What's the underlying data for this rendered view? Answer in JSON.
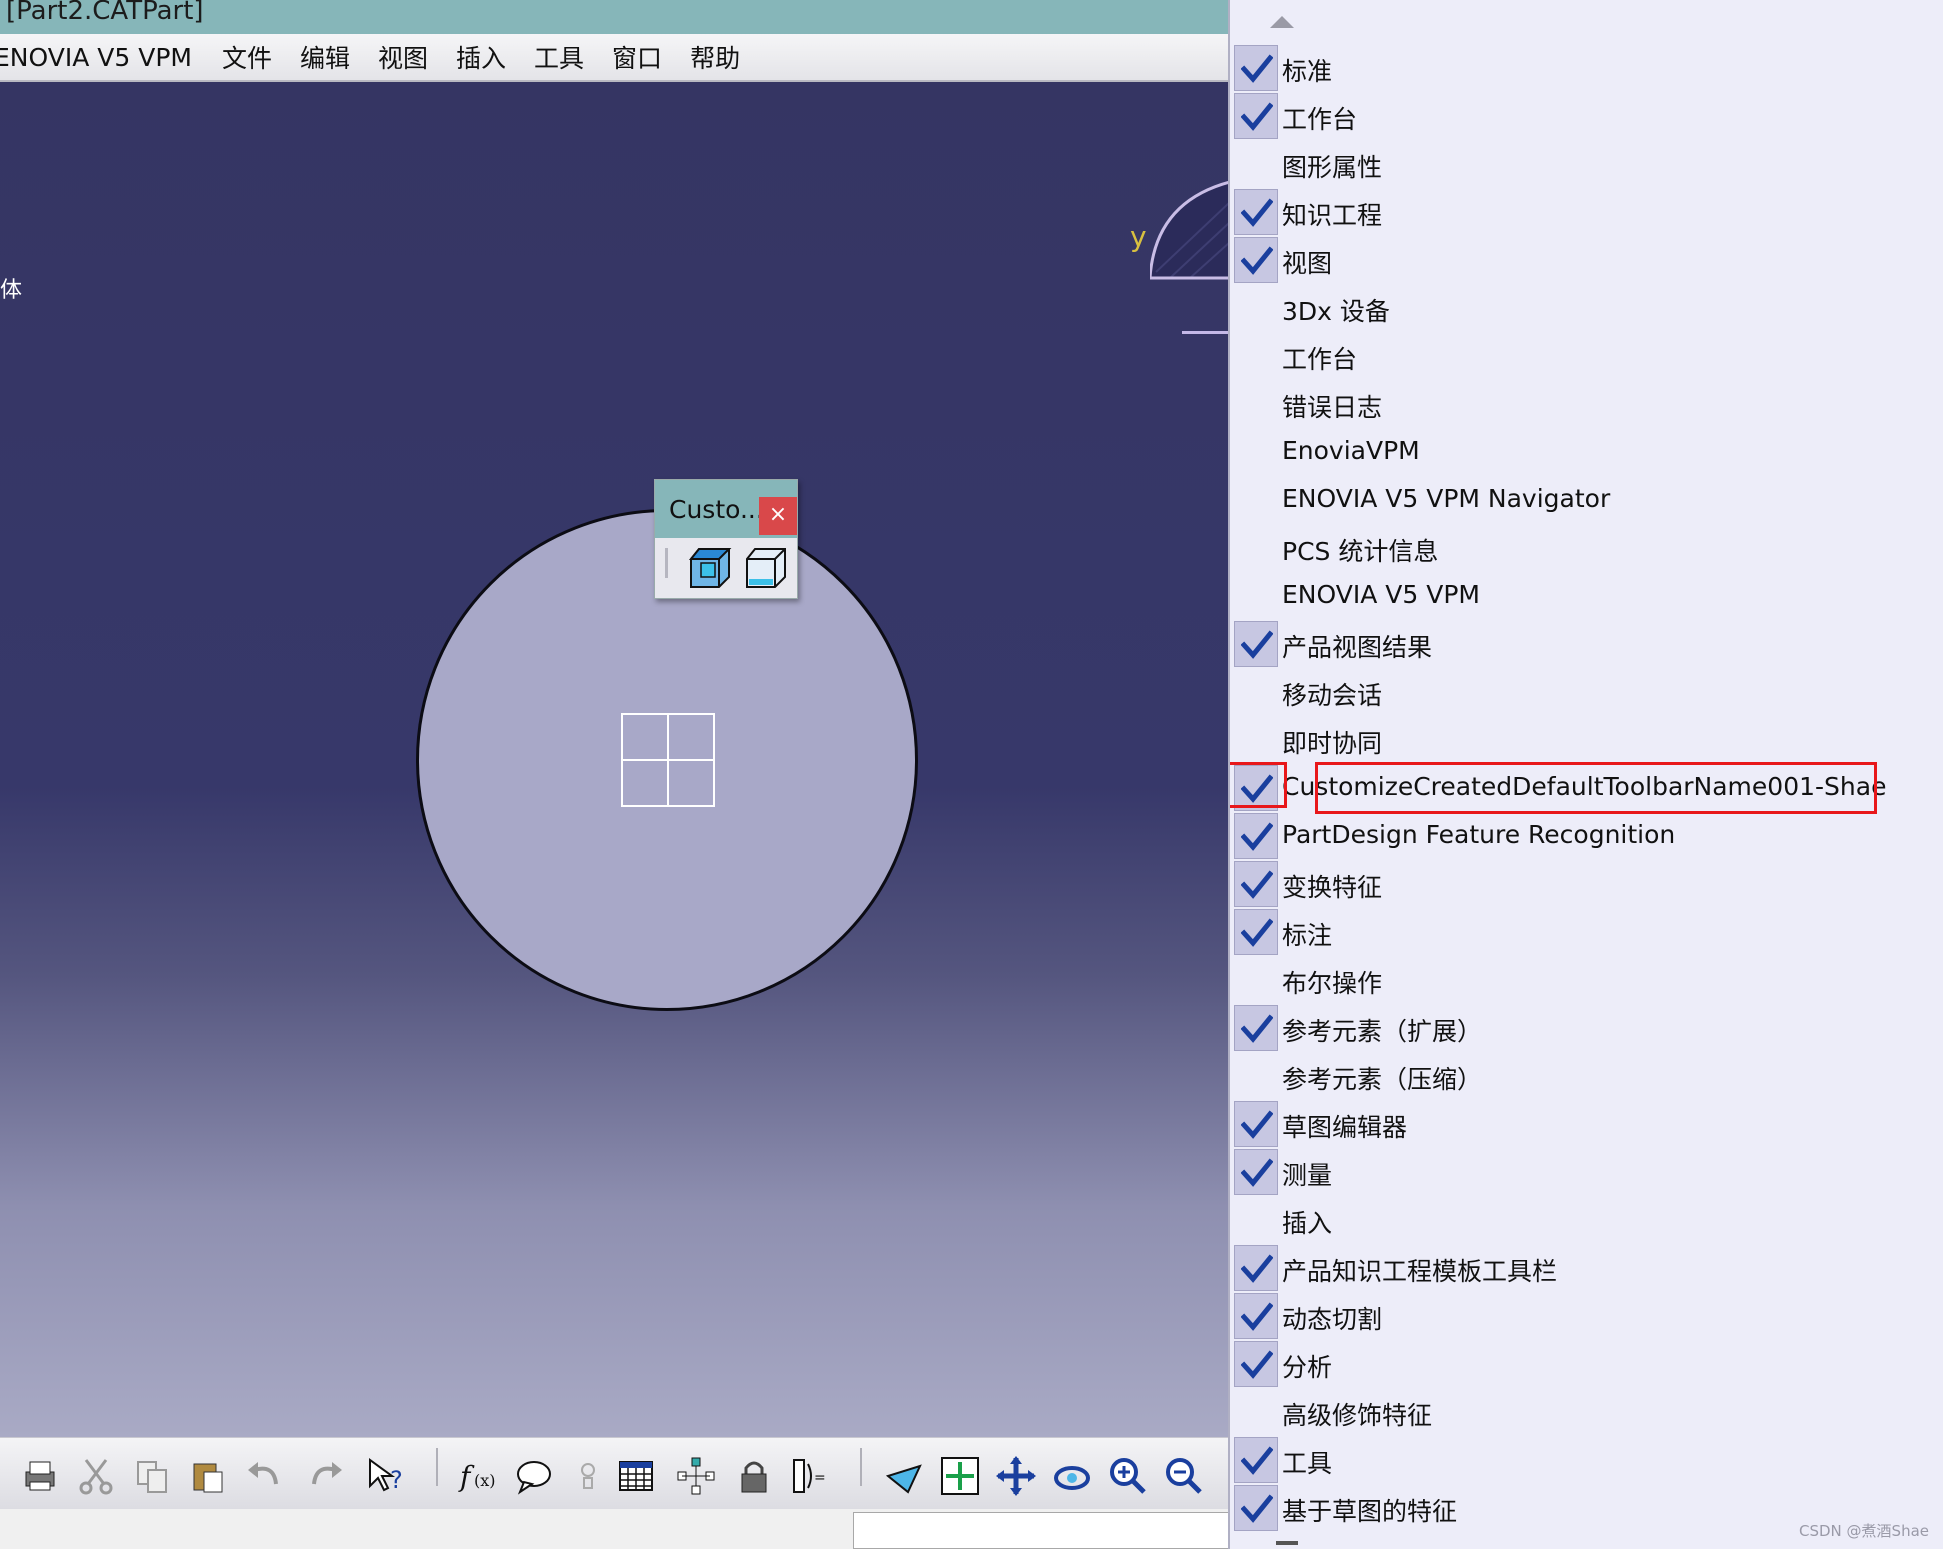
{
  "window": {
    "title": "[Part2.CATPart]"
  },
  "menubar": {
    "items": [
      "ENOVIA V5 VPM",
      "文件",
      "编辑",
      "视图",
      "插入",
      "工具",
      "窗口",
      "帮助"
    ]
  },
  "viewport": {
    "left_fragment": "体",
    "axis_label": "y"
  },
  "floating_toolbar": {
    "title": "Custo...",
    "close_glyph": "×",
    "icons": [
      "cube-icon-blue",
      "cube-icon-outline"
    ]
  },
  "context_menu": {
    "items": [
      {
        "label": "标准",
        "checked": true
      },
      {
        "label": "工作台",
        "checked": true
      },
      {
        "label": "图形属性",
        "checked": false
      },
      {
        "label": "知识工程",
        "checked": true
      },
      {
        "label": "视图",
        "checked": true
      },
      {
        "label": "3Dx 设备",
        "checked": false
      },
      {
        "label": "工作台",
        "checked": false
      },
      {
        "label": "错误日志",
        "checked": false
      },
      {
        "label": "EnoviaVPM",
        "checked": false
      },
      {
        "label": "ENOVIA V5 VPM Navigator",
        "checked": false
      },
      {
        "label": "PCS 统计信息",
        "checked": false
      },
      {
        "label": "ENOVIA V5 VPM",
        "checked": false
      },
      {
        "label": "产品视图结果",
        "checked": true
      },
      {
        "label": "移动会话",
        "checked": false
      },
      {
        "label": "即时协同",
        "checked": false
      },
      {
        "label": "CustomizeCreatedDefaultToolbarName001-Shae",
        "checked": true,
        "highlighted": true
      },
      {
        "label": "PartDesign Feature Recognition",
        "checked": true
      },
      {
        "label": "变换特征",
        "checked": true
      },
      {
        "label": "标注",
        "checked": true
      },
      {
        "label": "布尔操作",
        "checked": false
      },
      {
        "label": "参考元素（扩展）",
        "checked": true
      },
      {
        "label": "参考元素（压缩）",
        "checked": false
      },
      {
        "label": "草图编辑器",
        "checked": true
      },
      {
        "label": "测量",
        "checked": true
      },
      {
        "label": "插入",
        "checked": false
      },
      {
        "label": "产品知识工程模板工具栏",
        "checked": true
      },
      {
        "label": "动态切割",
        "checked": true
      },
      {
        "label": "分析",
        "checked": true
      },
      {
        "label": "高级修饰特征",
        "checked": false
      },
      {
        "label": "工具",
        "checked": true
      },
      {
        "label": "基于草图的特征",
        "checked": true
      }
    ]
  },
  "bottom_toolbar": {
    "icons": [
      "print-icon",
      "cut-icon",
      "copy-icon",
      "paste-icon",
      "undo-icon",
      "redo-icon",
      "help-icon",
      "formula-icon",
      "comment-icon",
      "light-icon",
      "table-icon",
      "tree-icon",
      "lock-icon",
      "param-icon",
      "fly-icon",
      "fit-all-icon",
      "pan-icon",
      "rotate-icon",
      "zoom-in-icon",
      "zoom-out-icon"
    ]
  },
  "watermark": "CSDN @煮酒Shae",
  "colors": {
    "titlebar": "#86b6b9",
    "highlight": "#e8171b",
    "check": "#1a3f9e",
    "menu_bg": "#ededf9"
  }
}
